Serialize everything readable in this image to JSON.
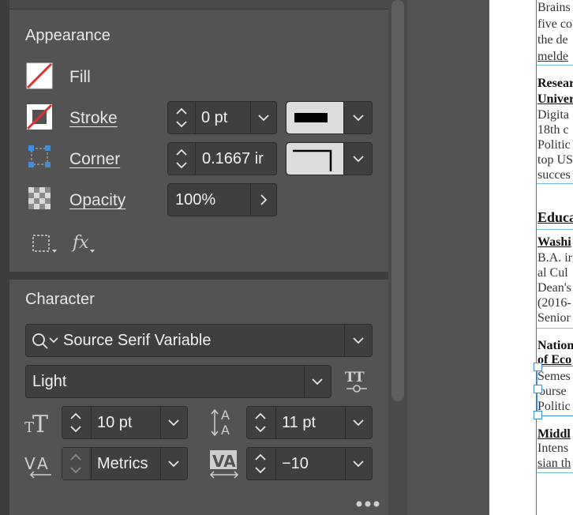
{
  "appearance": {
    "title": "Appearance",
    "fill_label": "Fill",
    "stroke_label": "Stroke",
    "stroke_weight": "0 pt",
    "corner_label": "Corner",
    "corner_size": "0.1667 ir",
    "opacity_label": "Opacity",
    "opacity_value": "100%"
  },
  "character": {
    "title": "Character",
    "font_family": "Source Serif Variable",
    "font_style": "Light",
    "font_size": "10 pt",
    "leading": "11 pt",
    "kerning": "Metrics",
    "tracking": "−10"
  },
  "document": {
    "lines_top": [
      "Brains",
      "five co",
      "the de",
      "melde"
    ],
    "research_head": [
      "Resear",
      "Univer"
    ],
    "research_body": [
      "Digita",
      "18th c",
      "Politic",
      "top US",
      "succes"
    ],
    "education_head": "Educa",
    "washington_head": "Washi",
    "washington_body": [
      "B.A. ir",
      "al Cul",
      "Dean's",
      "(2016-",
      "Senior"
    ],
    "national_head": [
      "Nation",
      "of Eco"
    ],
    "national_body": [
      "Semes",
      "ourse",
      "Politic"
    ],
    "middle_head": "Middl",
    "middle_body": [
      "Intens",
      "sian th"
    ]
  },
  "colors": {
    "accent_blue": "#3b8fdc",
    "red_slash": "#e03030",
    "page_border": "#9b4fd0"
  }
}
